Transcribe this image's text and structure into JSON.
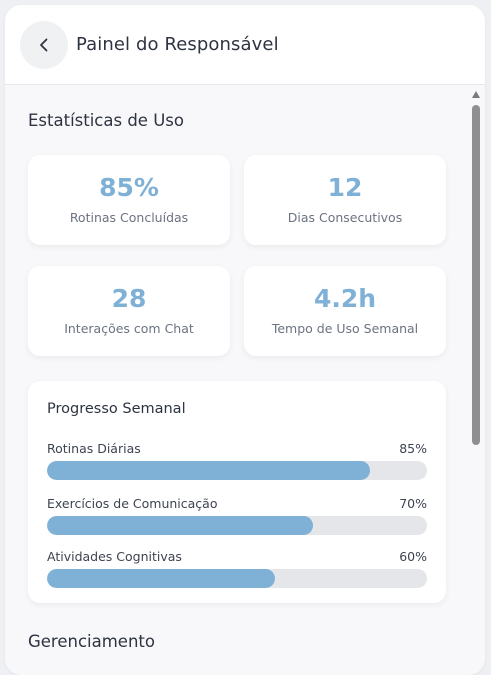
{
  "header": {
    "title": "Painel do Responsável",
    "back_icon": "chevron-left-icon"
  },
  "stats": {
    "section_title": "Estatísticas de Uso",
    "cards": [
      {
        "value": "85%",
        "label": "Rotinas Concluídas"
      },
      {
        "value": "12",
        "label": "Dias Consecutivos"
      },
      {
        "value": "28",
        "label": "Interações com Chat"
      },
      {
        "value": "4.2h",
        "label": "Tempo de Uso Semanal"
      }
    ],
    "accent_color": "#7fb0d6"
  },
  "progress": {
    "title": "Progresso Semanal",
    "items": [
      {
        "label": "Rotinas Diárias",
        "percent_text": "85%",
        "value": 0.85
      },
      {
        "label": "Exercícios de Comunicação",
        "percent_text": "70%",
        "value": 0.7
      },
      {
        "label": "Atividades Cognitivas",
        "percent_text": "60%",
        "value": 0.6
      }
    ]
  },
  "management": {
    "section_title": "Gerenciamento"
  }
}
